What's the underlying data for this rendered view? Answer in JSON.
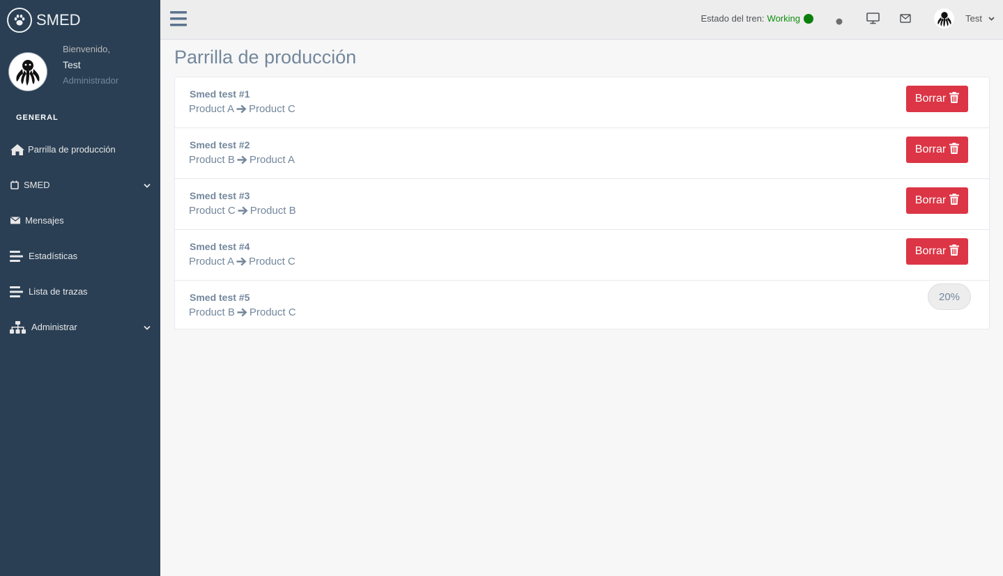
{
  "brand": {
    "name": "SMED",
    "icon": "paw-icon"
  },
  "profile": {
    "welcome": "Bienvenido,",
    "name": "Test",
    "role": "Administrador"
  },
  "sidebar": {
    "section_title": "GENERAL",
    "items": [
      {
        "label": "Parrilla de producción",
        "icon": "home-icon",
        "has_submenu": false
      },
      {
        "label": "SMED",
        "icon": "calendar-icon",
        "has_submenu": true
      },
      {
        "label": "Mensajes",
        "icon": "envelope-icon",
        "has_submenu": false
      },
      {
        "label": "Estadísticas",
        "icon": "align-left-icon",
        "has_submenu": false
      },
      {
        "label": "Lista de trazas",
        "icon": "align-left-icon",
        "has_submenu": false
      },
      {
        "label": "Administrar",
        "icon": "sitemap-icon",
        "has_submenu": true
      }
    ]
  },
  "topnav": {
    "train_label": "Estado del tren:",
    "train_status": "Working",
    "train_status_color": "#0B7F0B",
    "user_name": "Test"
  },
  "page": {
    "title": "Parrilla de producción"
  },
  "productions": [
    {
      "name": "Smed test #1",
      "from": "Product A",
      "to": "Product C",
      "action": "Borrar"
    },
    {
      "name": "Smed test #2",
      "from": "Product B",
      "to": "Product A",
      "action": "Borrar"
    },
    {
      "name": "Smed test #3",
      "from": "Product C",
      "to": "Product B",
      "action": "Borrar"
    },
    {
      "name": "Smed test #4",
      "from": "Product A",
      "to": "Product C",
      "action": "Borrar"
    },
    {
      "name": "Smed test #5",
      "from": "Product B",
      "to": "Product C",
      "progress": "20%"
    }
  ],
  "colors": {
    "sidebar_bg": "#2A3F54",
    "danger": "#DC3545",
    "text": "#73879C"
  }
}
